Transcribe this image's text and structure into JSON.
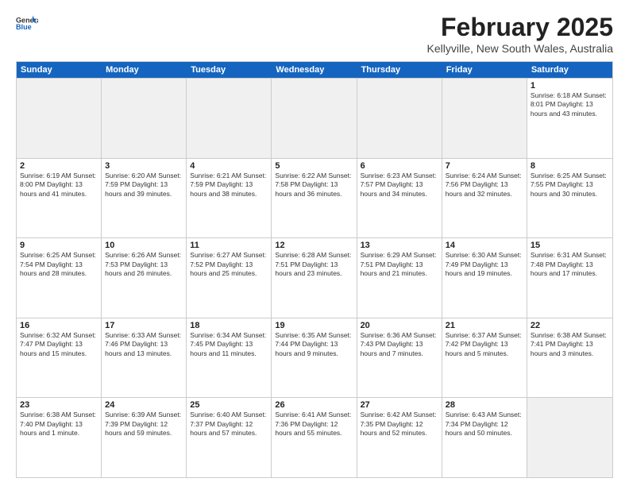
{
  "header": {
    "logo_general": "General",
    "logo_blue": "Blue",
    "title": "February 2025",
    "location": "Kellyville, New South Wales, Australia"
  },
  "days_of_week": [
    "Sunday",
    "Monday",
    "Tuesday",
    "Wednesday",
    "Thursday",
    "Friday",
    "Saturday"
  ],
  "weeks": [
    [
      {
        "day": "",
        "info": ""
      },
      {
        "day": "",
        "info": ""
      },
      {
        "day": "",
        "info": ""
      },
      {
        "day": "",
        "info": ""
      },
      {
        "day": "",
        "info": ""
      },
      {
        "day": "",
        "info": ""
      },
      {
        "day": "1",
        "info": "Sunrise: 6:18 AM\nSunset: 8:01 PM\nDaylight: 13 hours\nand 43 minutes."
      }
    ],
    [
      {
        "day": "2",
        "info": "Sunrise: 6:19 AM\nSunset: 8:00 PM\nDaylight: 13 hours\nand 41 minutes."
      },
      {
        "day": "3",
        "info": "Sunrise: 6:20 AM\nSunset: 7:59 PM\nDaylight: 13 hours\nand 39 minutes."
      },
      {
        "day": "4",
        "info": "Sunrise: 6:21 AM\nSunset: 7:59 PM\nDaylight: 13 hours\nand 38 minutes."
      },
      {
        "day": "5",
        "info": "Sunrise: 6:22 AM\nSunset: 7:58 PM\nDaylight: 13 hours\nand 36 minutes."
      },
      {
        "day": "6",
        "info": "Sunrise: 6:23 AM\nSunset: 7:57 PM\nDaylight: 13 hours\nand 34 minutes."
      },
      {
        "day": "7",
        "info": "Sunrise: 6:24 AM\nSunset: 7:56 PM\nDaylight: 13 hours\nand 32 minutes."
      },
      {
        "day": "8",
        "info": "Sunrise: 6:25 AM\nSunset: 7:55 PM\nDaylight: 13 hours\nand 30 minutes."
      }
    ],
    [
      {
        "day": "9",
        "info": "Sunrise: 6:25 AM\nSunset: 7:54 PM\nDaylight: 13 hours\nand 28 minutes."
      },
      {
        "day": "10",
        "info": "Sunrise: 6:26 AM\nSunset: 7:53 PM\nDaylight: 13 hours\nand 26 minutes."
      },
      {
        "day": "11",
        "info": "Sunrise: 6:27 AM\nSunset: 7:52 PM\nDaylight: 13 hours\nand 25 minutes."
      },
      {
        "day": "12",
        "info": "Sunrise: 6:28 AM\nSunset: 7:51 PM\nDaylight: 13 hours\nand 23 minutes."
      },
      {
        "day": "13",
        "info": "Sunrise: 6:29 AM\nSunset: 7:51 PM\nDaylight: 13 hours\nand 21 minutes."
      },
      {
        "day": "14",
        "info": "Sunrise: 6:30 AM\nSunset: 7:49 PM\nDaylight: 13 hours\nand 19 minutes."
      },
      {
        "day": "15",
        "info": "Sunrise: 6:31 AM\nSunset: 7:48 PM\nDaylight: 13 hours\nand 17 minutes."
      }
    ],
    [
      {
        "day": "16",
        "info": "Sunrise: 6:32 AM\nSunset: 7:47 PM\nDaylight: 13 hours\nand 15 minutes."
      },
      {
        "day": "17",
        "info": "Sunrise: 6:33 AM\nSunset: 7:46 PM\nDaylight: 13 hours\nand 13 minutes."
      },
      {
        "day": "18",
        "info": "Sunrise: 6:34 AM\nSunset: 7:45 PM\nDaylight: 13 hours\nand 11 minutes."
      },
      {
        "day": "19",
        "info": "Sunrise: 6:35 AM\nSunset: 7:44 PM\nDaylight: 13 hours\nand 9 minutes."
      },
      {
        "day": "20",
        "info": "Sunrise: 6:36 AM\nSunset: 7:43 PM\nDaylight: 13 hours\nand 7 minutes."
      },
      {
        "day": "21",
        "info": "Sunrise: 6:37 AM\nSunset: 7:42 PM\nDaylight: 13 hours\nand 5 minutes."
      },
      {
        "day": "22",
        "info": "Sunrise: 6:38 AM\nSunset: 7:41 PM\nDaylight: 13 hours\nand 3 minutes."
      }
    ],
    [
      {
        "day": "23",
        "info": "Sunrise: 6:38 AM\nSunset: 7:40 PM\nDaylight: 13 hours\nand 1 minute."
      },
      {
        "day": "24",
        "info": "Sunrise: 6:39 AM\nSunset: 7:39 PM\nDaylight: 12 hours\nand 59 minutes."
      },
      {
        "day": "25",
        "info": "Sunrise: 6:40 AM\nSunset: 7:37 PM\nDaylight: 12 hours\nand 57 minutes."
      },
      {
        "day": "26",
        "info": "Sunrise: 6:41 AM\nSunset: 7:36 PM\nDaylight: 12 hours\nand 55 minutes."
      },
      {
        "day": "27",
        "info": "Sunrise: 6:42 AM\nSunset: 7:35 PM\nDaylight: 12 hours\nand 52 minutes."
      },
      {
        "day": "28",
        "info": "Sunrise: 6:43 AM\nSunset: 7:34 PM\nDaylight: 12 hours\nand 50 minutes."
      },
      {
        "day": "",
        "info": ""
      }
    ]
  ]
}
